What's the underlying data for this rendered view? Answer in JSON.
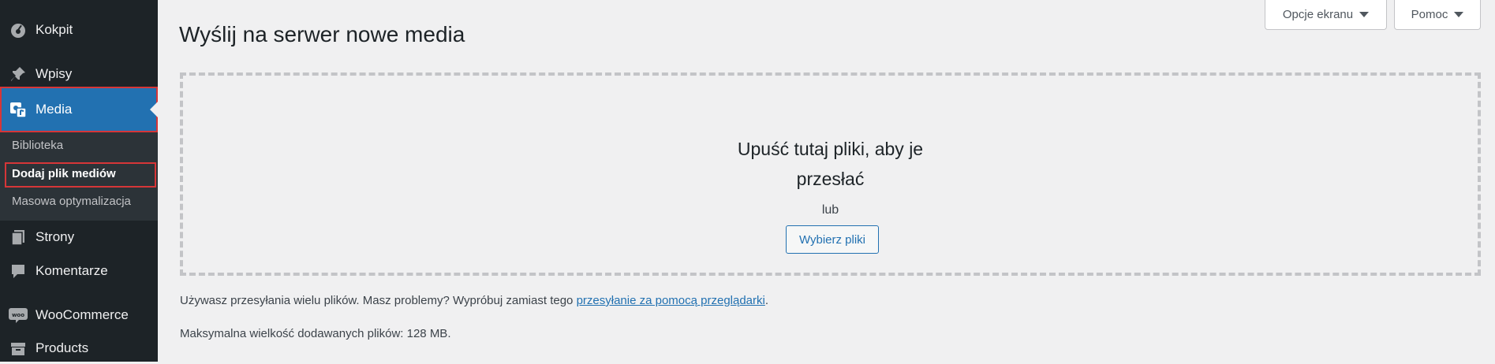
{
  "sidebar": {
    "items": [
      {
        "label": "Kokpit",
        "icon": "dashboard-icon"
      },
      {
        "label": "Wpisy",
        "icon": "pin-icon"
      },
      {
        "label": "Media",
        "icon": "media-icon"
      },
      {
        "label": "Strony",
        "icon": "pages-icon"
      },
      {
        "label": "Komentarze",
        "icon": "comment-icon"
      },
      {
        "label": "WooCommerce",
        "icon": "woocommerce-icon"
      },
      {
        "label": "Products",
        "icon": "archive-icon"
      }
    ],
    "media_submenu": [
      "Biblioteka",
      "Dodaj plik mediów",
      "Masowa optymalizacja"
    ]
  },
  "header": {
    "screen_options_label": "Opcje ekranu",
    "help_label": "Pomoc"
  },
  "main": {
    "title": "Wyślij na serwer nowe media",
    "drop_text_line1": "Upuść tutaj pliki, aby je",
    "drop_text_line2": "przesłać",
    "or_text": "lub",
    "select_files_label": "Wybierz pliki",
    "multi_upload_text": "Używasz przesyłania wielu plików. Masz problemy? Wypróbuj zamiast tego ",
    "browser_upload_link": "przesyłanie za pomocą przeglądarki",
    "period": ".",
    "max_size_text": "Maksymalna wielkość dodawanych plików: 128 MB."
  },
  "colors": {
    "sidebar_bg": "#1d2327",
    "accent": "#2271b1",
    "highlight_border": "#d63638"
  }
}
